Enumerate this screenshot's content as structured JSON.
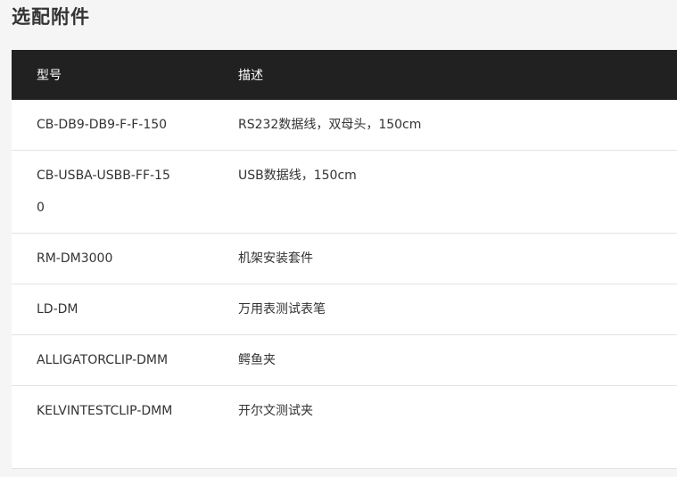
{
  "title": "选配附件",
  "table": {
    "headers": [
      "型号",
      "描述"
    ],
    "rows": [
      {
        "model": "CB-DB9-DB9-F-F-150",
        "desc": "RS232数据线，双母头，150cm"
      },
      {
        "model": "CB-USBA-USBB-FF-150",
        "desc": "USB数据线，150cm"
      },
      {
        "model": "RM-DM3000",
        "desc": "机架安装套件"
      },
      {
        "model": "LD-DM",
        "desc": "万用表测试表笔"
      },
      {
        "model": "ALLIGATORCLIP-DMM",
        "desc": "鳄鱼夹"
      },
      {
        "model": "KELVINTESTCLIP-DMM",
        "desc": "开尔文测试夹"
      }
    ]
  },
  "colors": {
    "header_bg": "#212121",
    "header_text": "#ffffff",
    "row_border": "#e3e3e3"
  }
}
